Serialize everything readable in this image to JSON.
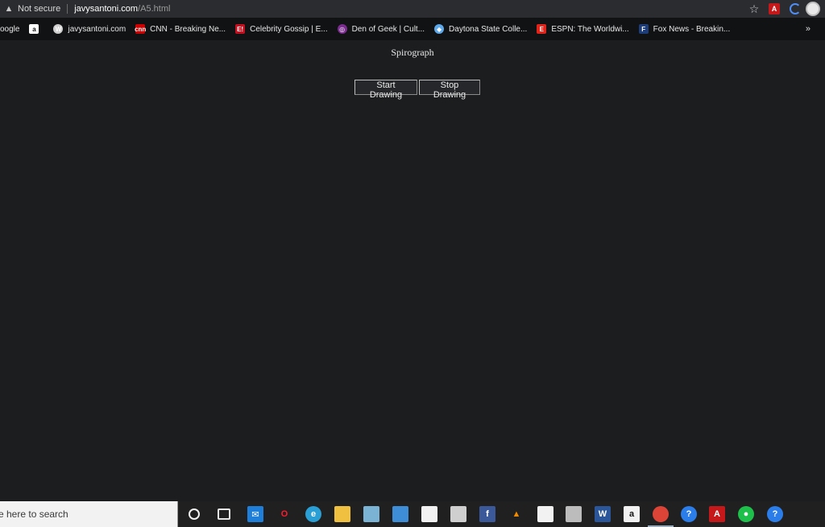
{
  "browser": {
    "security_label": "Not secure",
    "url_domain": "javysantoni.com",
    "url_path": "/A5.html"
  },
  "bookmarks": [
    {
      "label": "oogle",
      "icon": "google-icon",
      "color": "#111214"
    },
    {
      "label": "",
      "icon": "amazon-icon",
      "color": "#ffffff"
    },
    {
      "label": "javysantoni.com",
      "icon": "wordpress-icon",
      "color": "#cfcfcf"
    },
    {
      "label": "CNN - Breaking Ne...",
      "icon": "cnn-icon",
      "color": "#cc0000"
    },
    {
      "label": "Celebrity Gossip | E...",
      "icon": "eonline-icon",
      "color": "#c40f1f"
    },
    {
      "label": "Den of Geek | Cult...",
      "icon": "denofgeek-icon",
      "color": "#7a2b8e"
    },
    {
      "label": "Daytona State Colle...",
      "icon": "daytona-icon",
      "color": "#5da9e9"
    },
    {
      "label": "ESPN: The Worldwi...",
      "icon": "espn-icon",
      "color": "#e2231a"
    },
    {
      "label": "Fox News - Breakin...",
      "icon": "foxnews-icon",
      "color": "#1d3d7a"
    }
  ],
  "bookmarks_more": "»",
  "page": {
    "title": "Spirograph",
    "start_label": "Start Drawing",
    "stop_label": "Stop Drawing"
  },
  "taskbar": {
    "search_placeholder": "e here to search",
    "apps": [
      {
        "name": "cortana-icon"
      },
      {
        "name": "task-view-icon"
      },
      {
        "name": "mail-icon"
      },
      {
        "name": "opera-icon"
      },
      {
        "name": "edge-icon"
      },
      {
        "name": "file-explorer-icon"
      },
      {
        "name": "notepad-icon"
      },
      {
        "name": "contacts-icon"
      },
      {
        "name": "store-icon"
      },
      {
        "name": "paint-icon"
      },
      {
        "name": "facebook-icon"
      },
      {
        "name": "vlc-icon"
      },
      {
        "name": "document-icon"
      },
      {
        "name": "network-icon"
      },
      {
        "name": "word-icon"
      },
      {
        "name": "amazon-icon"
      },
      {
        "name": "chrome-icon"
      },
      {
        "name": "help-icon"
      },
      {
        "name": "acrobat-icon"
      },
      {
        "name": "green-app-icon"
      },
      {
        "name": "help-tray-icon"
      }
    ]
  }
}
